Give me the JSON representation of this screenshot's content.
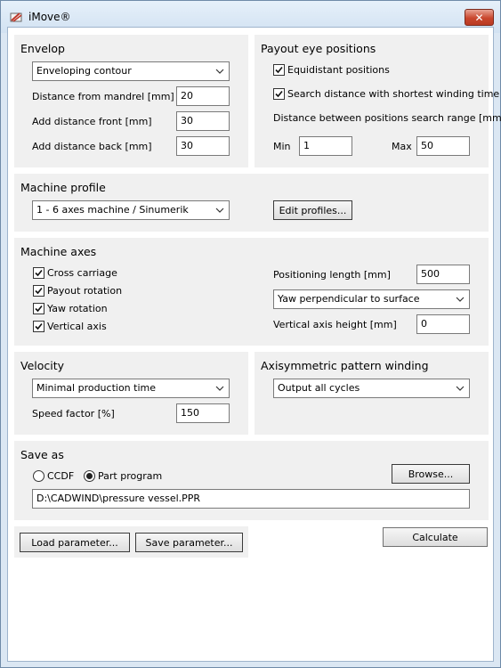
{
  "window": {
    "title": "iMove®",
    "close_glyph": "✕"
  },
  "envelop": {
    "title": "Envelop",
    "contour_selected": "Enveloping contour",
    "distance_mandrel_label": "Distance from mandrel [mm]",
    "distance_mandrel_value": "20",
    "add_front_label": "Add distance front [mm]",
    "add_front_value": "30",
    "add_back_label": "Add distance back [mm]",
    "add_back_value": "30"
  },
  "payout": {
    "title": "Payout eye positions",
    "equidistant_label": "Equidistant positions",
    "equidistant_checked": true,
    "search_label": "Search distance with shortest winding time",
    "search_checked": true,
    "range_label": "Distance between positions search range [mm]",
    "min_label": "Min",
    "min_value": "1",
    "max_label": "Max",
    "max_value": "50"
  },
  "machine_profile": {
    "title": "Machine profile",
    "selected": "1 - 6 axes machine / Sinumerik",
    "edit_label": "Edit profiles..."
  },
  "machine_axes": {
    "title": "Machine axes",
    "axes": [
      {
        "label": "Cross carriage",
        "checked": true
      },
      {
        "label": "Payout rotation",
        "checked": true
      },
      {
        "label": "Yaw rotation",
        "checked": true
      },
      {
        "label": "Vertical axis",
        "checked": true
      }
    ],
    "positioning_label": "Positioning length [mm]",
    "positioning_value": "500",
    "yaw_mode_selected": "Yaw perpendicular to surface",
    "vertical_height_label": "Vertical axis height [mm]",
    "vertical_height_value": "0"
  },
  "velocity": {
    "title": "Velocity",
    "mode_selected": "Minimal production time",
    "speed_label": "Speed factor [%]",
    "speed_value": "150"
  },
  "axisymmetric": {
    "title": "Axisymmetric pattern winding",
    "selected": "Output all cycles"
  },
  "save_as": {
    "title": "Save as",
    "ccdf_label": "CCDF",
    "part_program_label": "Part program",
    "selected": "part_program",
    "browse_label": "Browse...",
    "path_value": "D:\\CADWIND\\pressure vessel.PPR"
  },
  "footer": {
    "load_label": "Load parameter...",
    "save_label": "Save parameter...",
    "calculate_label": "Calculate"
  },
  "colors": {
    "window_frame": "#dbe7f3",
    "panel_bg": "#f0f0f0",
    "close_button": "#c9472e"
  },
  "icons": {
    "app": "app-logo-icon",
    "close": "close-icon",
    "chevron": "chevron-down-icon",
    "check": "checkmark-icon"
  }
}
